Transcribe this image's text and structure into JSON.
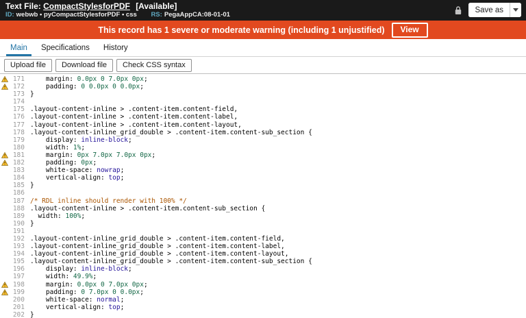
{
  "colors": {
    "header_bg": "#1a1a1a",
    "banner_bg": "#e2491f",
    "tab_active": "#2274a5",
    "meta_label": "#5fa8c0",
    "warning_icon_fill": "#fcc12f",
    "warning_icon_stroke": "#8a6d1a",
    "line_number": "#999999",
    "tok_plain": "#000000",
    "tok_number": "#116644",
    "tok_keyword": "#221199",
    "tok_comment": "#aa5500"
  },
  "header": {
    "title_prefix": "Text File:",
    "record_name": "CompactStylesforPDF",
    "availability": "[Available]",
    "id_label": "ID:",
    "id_value": "webwb • pyCompactStylesforPDF • css",
    "rs_label": "RS:",
    "rs_value": "PegaAppCA:08-01-01",
    "save_as_label": "Save as"
  },
  "warning_banner": {
    "text": "This record has 1 severe or moderate warning (including 1 unjustified)",
    "view_label": "View"
  },
  "tabs": [
    {
      "label": "Main",
      "active": true
    },
    {
      "label": "Specifications",
      "active": false
    },
    {
      "label": "History",
      "active": false
    }
  ],
  "toolbar": {
    "buttons": [
      "Upload file",
      "Download file",
      "Check CSS syntax"
    ]
  },
  "editor": {
    "first_line_number": 171,
    "last_line_number": 202,
    "lines": [
      {
        "n": 171,
        "w": true,
        "t": [
          [
            "    margin: ",
            "p"
          ],
          [
            "0.0px",
            "n"
          ],
          [
            " ",
            "p"
          ],
          [
            "0",
            "n"
          ],
          [
            " ",
            "p"
          ],
          [
            "7.0px",
            "n"
          ],
          [
            " ",
            "p"
          ],
          [
            "0px",
            "n"
          ],
          [
            ";",
            "p"
          ]
        ]
      },
      {
        "n": 172,
        "w": true,
        "t": [
          [
            "    padding: ",
            "p"
          ],
          [
            "0",
            "n"
          ],
          [
            " ",
            "p"
          ],
          [
            "0.0px",
            "n"
          ],
          [
            " ",
            "p"
          ],
          [
            "0",
            "n"
          ],
          [
            " ",
            "p"
          ],
          [
            "0.0px",
            "n"
          ],
          [
            ";",
            "p"
          ]
        ]
      },
      {
        "n": 173,
        "t": [
          [
            "}",
            "p"
          ]
        ]
      },
      {
        "n": 174,
        "t": []
      },
      {
        "n": 175,
        "t": [
          [
            ".layout-content-inline > .content-item.content-field,",
            "p"
          ]
        ]
      },
      {
        "n": 176,
        "t": [
          [
            ".layout-content-inline > .content-item.content-label,",
            "p"
          ]
        ]
      },
      {
        "n": 177,
        "t": [
          [
            ".layout-content-inline > .content-item.content-layout,",
            "p"
          ]
        ]
      },
      {
        "n": 178,
        "t": [
          [
            ".layout-content-inline_grid_double > .content-item.content-sub_section {",
            "p"
          ]
        ]
      },
      {
        "n": 179,
        "t": [
          [
            "    display: ",
            "p"
          ],
          [
            "inline-block",
            "k"
          ],
          [
            ";",
            "p"
          ]
        ]
      },
      {
        "n": 180,
        "t": [
          [
            "    width: ",
            "p"
          ],
          [
            "1%",
            "n"
          ],
          [
            ";",
            "p"
          ]
        ]
      },
      {
        "n": 181,
        "w": true,
        "t": [
          [
            "    margin: ",
            "p"
          ],
          [
            "0px",
            "n"
          ],
          [
            " ",
            "p"
          ],
          [
            "7.0px",
            "n"
          ],
          [
            " ",
            "p"
          ],
          [
            "7.0px",
            "n"
          ],
          [
            " ",
            "p"
          ],
          [
            "0px",
            "n"
          ],
          [
            ";",
            "p"
          ]
        ]
      },
      {
        "n": 182,
        "w": true,
        "t": [
          [
            "    padding: ",
            "p"
          ],
          [
            "0px",
            "n"
          ],
          [
            ";",
            "p"
          ]
        ]
      },
      {
        "n": 183,
        "t": [
          [
            "    white-space: ",
            "p"
          ],
          [
            "nowrap",
            "k"
          ],
          [
            ";",
            "p"
          ]
        ]
      },
      {
        "n": 184,
        "t": [
          [
            "    vertical-align: ",
            "p"
          ],
          [
            "top",
            "k"
          ],
          [
            ";",
            "p"
          ]
        ]
      },
      {
        "n": 185,
        "t": [
          [
            "}",
            "p"
          ]
        ]
      },
      {
        "n": 186,
        "t": []
      },
      {
        "n": 187,
        "t": [
          [
            "/* RDL inline should render with 100% */",
            "c"
          ]
        ]
      },
      {
        "n": 188,
        "t": [
          [
            ".layout-content-inline > .content-item.content-sub_section {",
            "p"
          ]
        ]
      },
      {
        "n": 189,
        "t": [
          [
            "  width: ",
            "p"
          ],
          [
            "100%",
            "n"
          ],
          [
            ";",
            "p"
          ]
        ]
      },
      {
        "n": 190,
        "t": [
          [
            "}",
            "p"
          ]
        ]
      },
      {
        "n": 191,
        "t": []
      },
      {
        "n": 192,
        "t": [
          [
            ".layout-content-inline_grid_double > .content-item.content-field,",
            "p"
          ]
        ]
      },
      {
        "n": 193,
        "t": [
          [
            ".layout-content-inline_grid_double > .content-item.content-label,",
            "p"
          ]
        ]
      },
      {
        "n": 194,
        "t": [
          [
            ".layout-content-inline_grid_double > .content-item.content-layout,",
            "p"
          ]
        ]
      },
      {
        "n": 195,
        "t": [
          [
            ".layout-content-inline_grid_double > .content-item.content-sub_section {",
            "p"
          ]
        ]
      },
      {
        "n": 196,
        "t": [
          [
            "    display: ",
            "p"
          ],
          [
            "inline-block",
            "k"
          ],
          [
            ";",
            "p"
          ]
        ]
      },
      {
        "n": 197,
        "t": [
          [
            "    width: ",
            "p"
          ],
          [
            "49.9%",
            "n"
          ],
          [
            ";",
            "p"
          ]
        ]
      },
      {
        "n": 198,
        "w": true,
        "t": [
          [
            "    margin: ",
            "p"
          ],
          [
            "0.0px",
            "n"
          ],
          [
            " ",
            "p"
          ],
          [
            "0",
            "n"
          ],
          [
            " ",
            "p"
          ],
          [
            "7.0px",
            "n"
          ],
          [
            " ",
            "p"
          ],
          [
            "0px",
            "n"
          ],
          [
            ";",
            "p"
          ]
        ]
      },
      {
        "n": 199,
        "w": true,
        "t": [
          [
            "    padding: ",
            "p"
          ],
          [
            "0",
            "n"
          ],
          [
            " ",
            "p"
          ],
          [
            "7.0px",
            "n"
          ],
          [
            " ",
            "p"
          ],
          [
            "0",
            "n"
          ],
          [
            " ",
            "p"
          ],
          [
            "0.0px",
            "n"
          ],
          [
            ";",
            "p"
          ]
        ]
      },
      {
        "n": 200,
        "t": [
          [
            "    white-space: ",
            "p"
          ],
          [
            "normal",
            "k"
          ],
          [
            ";",
            "p"
          ]
        ]
      },
      {
        "n": 201,
        "t": [
          [
            "    vertical-align: ",
            "p"
          ],
          [
            "top",
            "k"
          ],
          [
            ";",
            "p"
          ]
        ]
      },
      {
        "n": 202,
        "t": [
          [
            "}",
            "p"
          ]
        ]
      }
    ]
  }
}
